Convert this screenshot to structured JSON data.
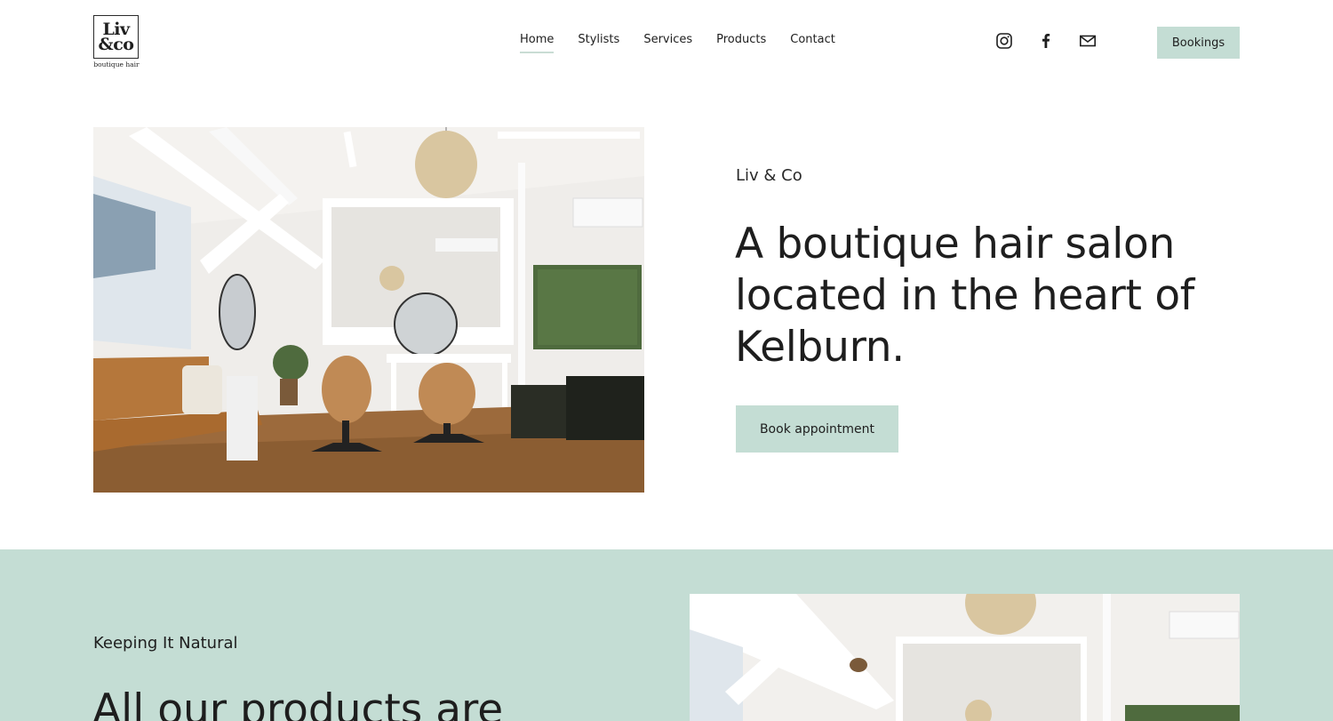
{
  "brand": {
    "logo_line1": "Liv",
    "logo_line2": "&co",
    "logo_tagline": "boutique hair"
  },
  "nav": {
    "items": [
      {
        "label": "Home",
        "active": true
      },
      {
        "label": "Stylists",
        "active": false
      },
      {
        "label": "Services",
        "active": false
      },
      {
        "label": "Products",
        "active": false
      },
      {
        "label": "Contact",
        "active": false
      }
    ]
  },
  "social": {
    "icons": [
      "instagram-icon",
      "facebook-icon",
      "email-icon"
    ]
  },
  "header": {
    "bookings_label": "Bookings"
  },
  "hero": {
    "eyebrow": "Liv & Co",
    "heading": "A boutique hair salon located in the heart of Kelburn.",
    "button_label": "Book appointment"
  },
  "section2": {
    "eyebrow": "Keeping It Natural",
    "heading": "All our products are"
  },
  "colors": {
    "accent": "#c4ddd4",
    "text": "#1e1e1e",
    "background": "#ffffff"
  }
}
